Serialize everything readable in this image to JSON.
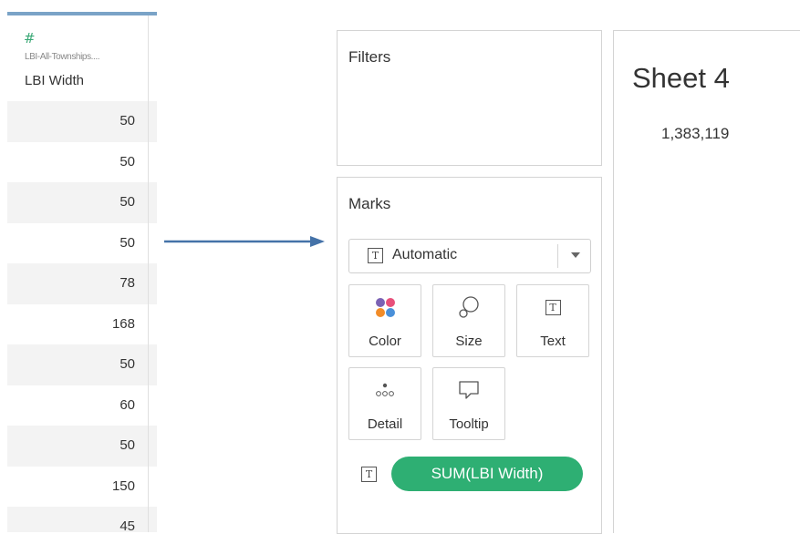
{
  "data_column": {
    "source_name": "LBI-All-Townships....",
    "field_name": "LBI Width",
    "field_type_icon": "hash-icon",
    "values": [
      "50",
      "50",
      "50",
      "50",
      "78",
      "168",
      "50",
      "60",
      "50",
      "150",
      "45"
    ]
  },
  "filters": {
    "title": "Filters"
  },
  "marks": {
    "title": "Marks",
    "mark_type": "Automatic",
    "mark_type_icon": "T",
    "tiles": [
      {
        "label": "Color",
        "icon": "color-icon"
      },
      {
        "label": "Size",
        "icon": "size-icon"
      },
      {
        "label": "Text",
        "icon": "text-icon"
      },
      {
        "label": "Detail",
        "icon": "detail-icon"
      },
      {
        "label": "Tooltip",
        "icon": "tooltip-icon"
      }
    ],
    "pill_icon": "T",
    "pill_label": "SUM(LBI Width)",
    "pill_color": "#2eaf73"
  },
  "sheet": {
    "title": "Sheet 4",
    "value": "1,383,119"
  },
  "colors": {
    "accent_bar": "#7aa3c7",
    "arrow": "#4472a8",
    "hash": "#3aa876"
  }
}
